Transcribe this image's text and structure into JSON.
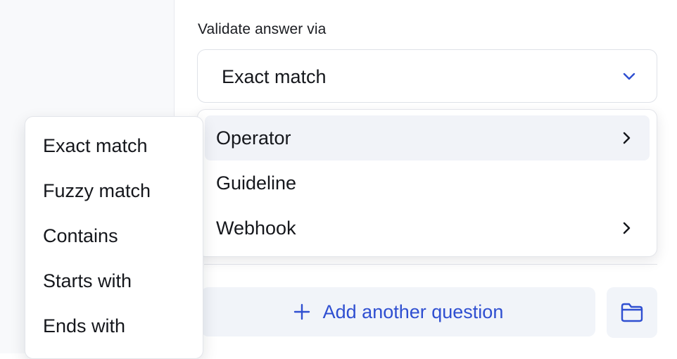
{
  "form": {
    "label": "Validate answer via",
    "selected_value": "Exact match"
  },
  "validation_menu": {
    "items": [
      {
        "label": "Operator",
        "has_submenu": true,
        "active": true
      },
      {
        "label": "Guideline",
        "has_submenu": false,
        "active": false
      },
      {
        "label": "Webhook",
        "has_submenu": true,
        "active": false
      }
    ]
  },
  "operator_submenu": {
    "items": [
      {
        "label": "Exact match"
      },
      {
        "label": "Fuzzy match"
      },
      {
        "label": "Contains"
      },
      {
        "label": "Starts with"
      },
      {
        "label": "Ends with"
      }
    ]
  },
  "actions": {
    "add_question_label": "Add another question",
    "folder_icon": "folder-icon"
  },
  "colors": {
    "accent": "#2f4fd1",
    "button_bg": "#f1f4f9",
    "menu_active_bg": "#f1f3f8"
  }
}
